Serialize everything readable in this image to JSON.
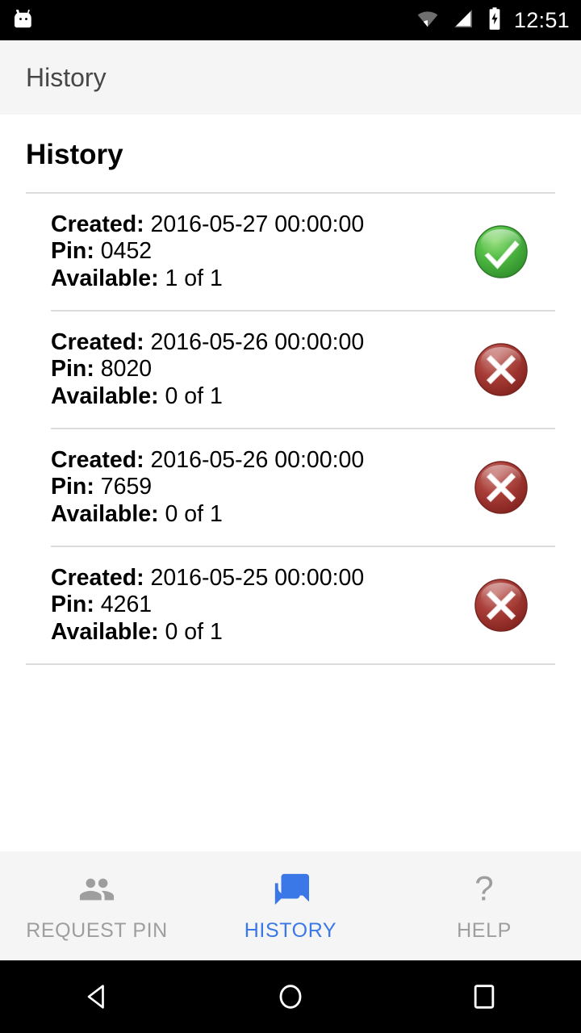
{
  "status_bar": {
    "app_logo": "android-mascot-icon",
    "icons": [
      "wifi-icon",
      "cellular-signal-icon",
      "battery-charging-icon"
    ],
    "time": "12:51"
  },
  "toolbar": {
    "title": "History"
  },
  "page": {
    "title": "History"
  },
  "history": {
    "labels": {
      "created": "Created:",
      "pin": "Pin:",
      "available": "Available:"
    },
    "items": [
      {
        "created": "2016-05-27 00:00:00",
        "pin": "0452",
        "available": "1 of 1",
        "status": "success",
        "status_icon": "check-circle-icon"
      },
      {
        "created": "2016-05-26 00:00:00",
        "pin": "8020",
        "available": "0 of 1",
        "status": "failed",
        "status_icon": "x-circle-icon"
      },
      {
        "created": "2016-05-26 00:00:00",
        "pin": "7659",
        "available": "0 of 1",
        "status": "failed",
        "status_icon": "x-circle-icon"
      },
      {
        "created": "2016-05-25 00:00:00",
        "pin": "4261",
        "available": "0 of 1",
        "status": "failed",
        "status_icon": "x-circle-icon"
      }
    ]
  },
  "tabs": {
    "active_index": 1,
    "items": [
      {
        "label": "REQUEST PIN",
        "icon": "people-icon",
        "active": false
      },
      {
        "label": "HISTORY",
        "icon": "forum-icon",
        "active": true
      },
      {
        "label": "HELP",
        "icon": "question-mark-icon",
        "active": false
      }
    ]
  },
  "nav_bar": {
    "back": "back-triangle-icon",
    "home": "home-circle-icon",
    "recents": "recents-square-icon"
  },
  "colors": {
    "accent": "#3b78e7",
    "toolbar_bg": "#f5f5f5",
    "success": "#3faa3f",
    "error": "#a63232",
    "inactive_tab": "#9e9e9e"
  }
}
